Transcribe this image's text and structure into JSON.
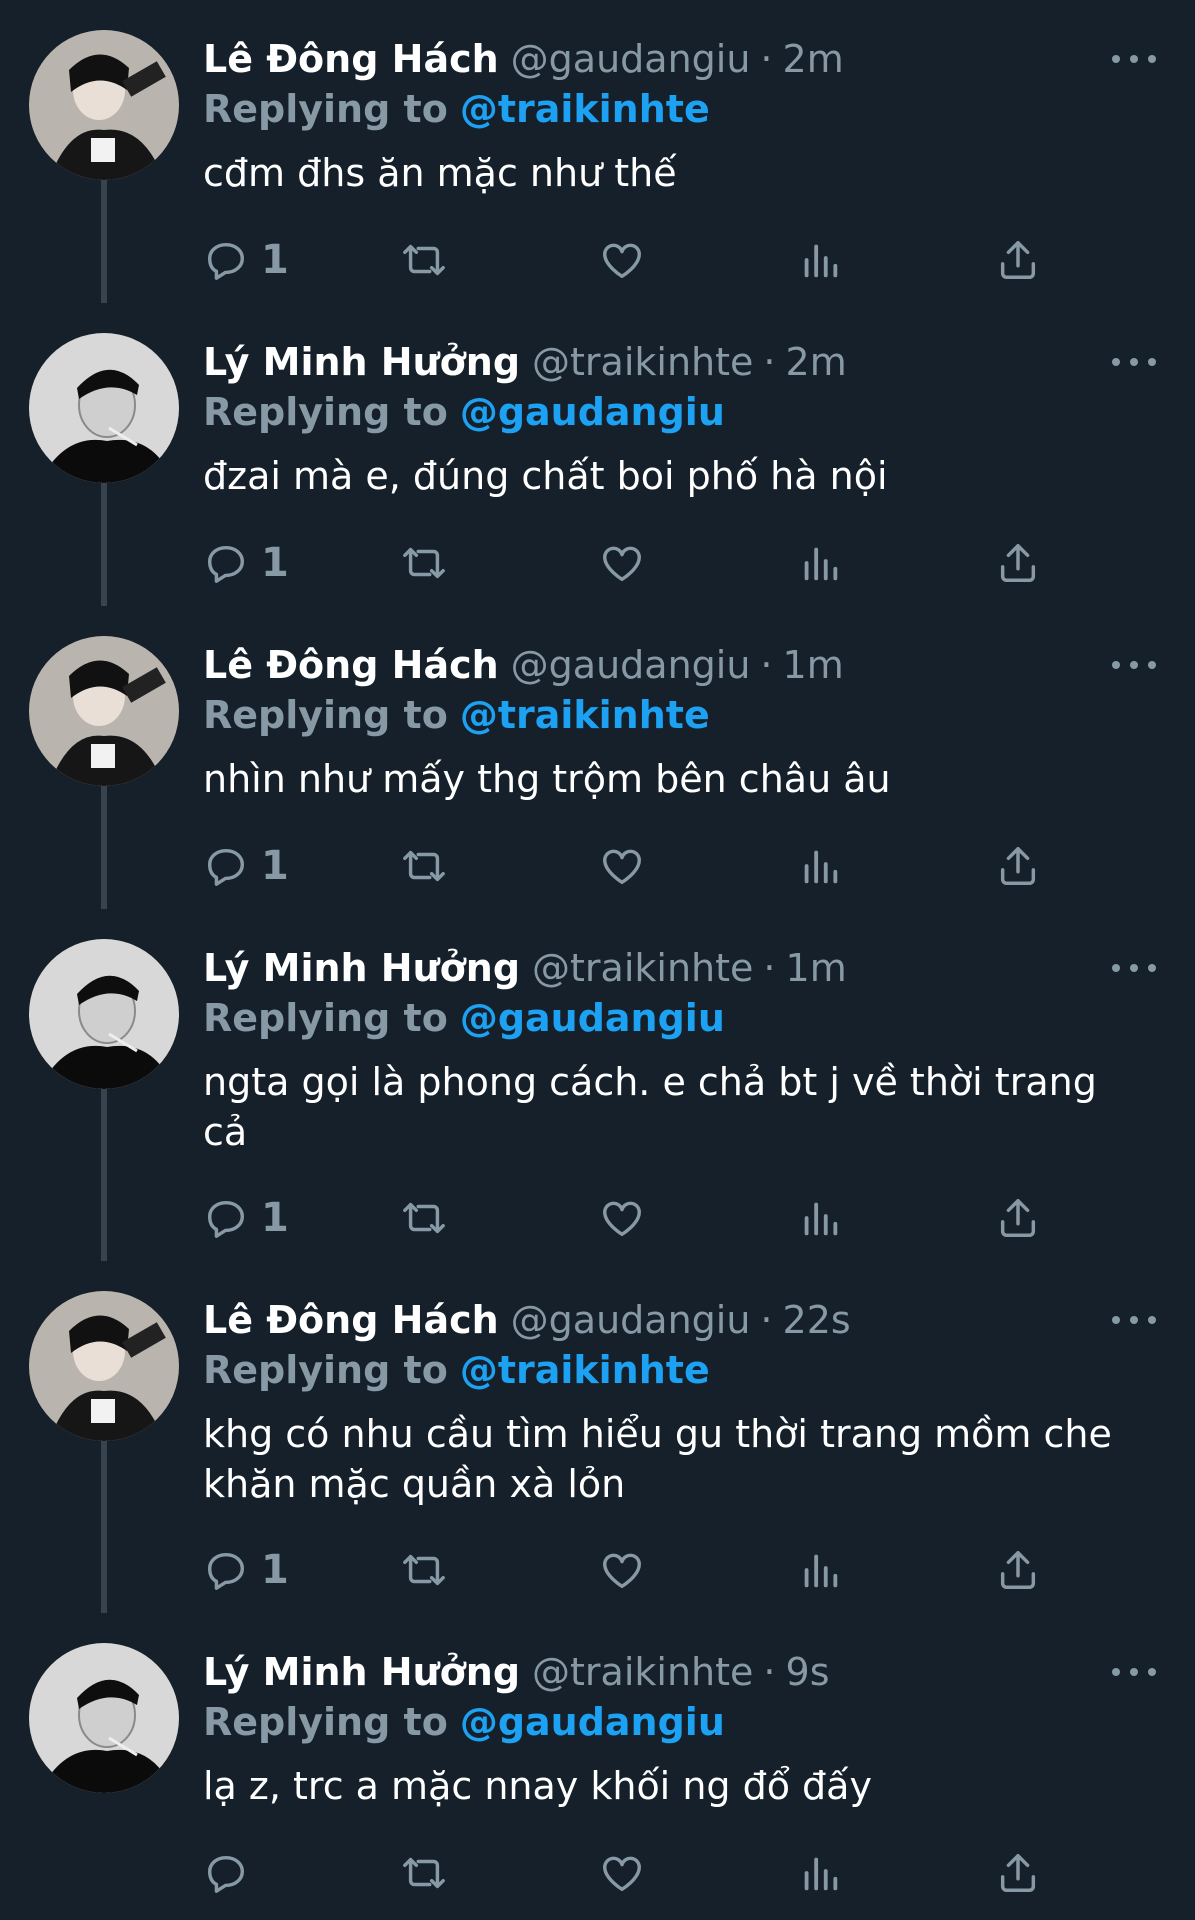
{
  "theme": {
    "background": "#15202b",
    "muted": "#8899a6",
    "link": "#1da1f2",
    "text": "#ffffff",
    "line": "#38444d"
  },
  "reply_label": "Replying to",
  "tweets": [
    {
      "name": "Lê Đông Hách",
      "handle": "@gaudangiu",
      "separator": "·",
      "time": "2m",
      "reply_to": "@traikinhte",
      "text": "cđm đhs ăn mặc như thế",
      "reply_count": "1"
    },
    {
      "name": "Lý Minh Hưởng",
      "handle": "@traikinhte",
      "separator": "·",
      "time": "2m",
      "reply_to": "@gaudangiu",
      "text": "đzai mà e, đúng chất boi phố hà nội",
      "reply_count": "1"
    },
    {
      "name": "Lê Đông Hách",
      "handle": "@gaudangiu",
      "separator": "·",
      "time": "1m",
      "reply_to": "@traikinhte",
      "text": "nhìn như mấy thg trộm bên châu âu",
      "reply_count": "1"
    },
    {
      "name": "Lý Minh Hưởng",
      "handle": "@traikinhte",
      "separator": "·",
      "time": "1m",
      "reply_to": "@gaudangiu",
      "text": "ngta gọi là phong cách. e chả bt j về thời trang cả",
      "reply_count": "1"
    },
    {
      "name": "Lê Đông Hách",
      "handle": "@gaudangiu",
      "separator": "·",
      "time": "22s",
      "reply_to": "@traikinhte",
      "text": "khg có nhu cầu tìm hiểu gu thời trang mồm che khăn mặc quần xà lỏn",
      "reply_count": "1"
    },
    {
      "name": "Lý Minh Hưởng",
      "handle": "@traikinhte",
      "separator": "·",
      "time": "9s",
      "reply_to": "@gaudangiu",
      "text": "lạ z, trc a mặc nnay khối ng đổ đấy",
      "reply_count": ""
    }
  ],
  "icons": {
    "reply": "reply-icon",
    "retweet": "retweet-icon",
    "like": "heart-icon",
    "analytics": "analytics-icon",
    "share": "share-icon",
    "more": "more-icon"
  }
}
